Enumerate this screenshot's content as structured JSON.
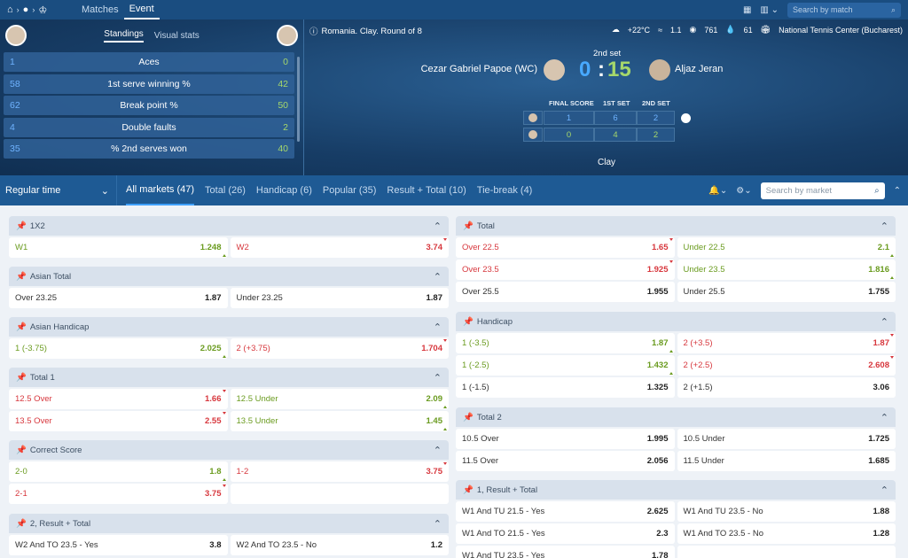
{
  "top": {
    "tabs": [
      "Matches",
      "Event"
    ],
    "active_tab": "Event",
    "search_placeholder": "Search by match"
  },
  "stats": {
    "tabs": [
      "Standings",
      "Visual stats"
    ],
    "rows": [
      {
        "left": "1",
        "name": "Aces",
        "right": "0"
      },
      {
        "left": "58",
        "name": "1st serve winning %",
        "right": "42"
      },
      {
        "left": "62",
        "name": "Break point %",
        "right": "50"
      },
      {
        "left": "4",
        "name": "Double faults",
        "right": "2"
      },
      {
        "left": "35",
        "name": "% 2nd serves won",
        "right": "40"
      }
    ]
  },
  "event": {
    "info": "Romania. Clay. Round of 8",
    "weather": {
      "temp": "+22°C",
      "wind": "1.1",
      "pressure": "761",
      "humidity": "61",
      "venue": "National Tennis Center (Bucharest)"
    },
    "set_label": "2nd set",
    "player1": "Cezar Gabriel Papoe (WC)",
    "player2": "Aljaz Jeran",
    "score1": "0",
    "colon": ":",
    "score2": "15",
    "scoreboard_heads": [
      "FINAL SCORE",
      "1ST SET",
      "2ND SET"
    ],
    "p1_scores": [
      "1",
      "6",
      "2"
    ],
    "p2_scores": [
      "0",
      "4",
      "2"
    ],
    "surface": "Clay"
  },
  "filters": {
    "period": "Regular time",
    "tabs": [
      {
        "label": "All markets (47)"
      },
      {
        "label": "Total (26)"
      },
      {
        "label": "Handicap (6)"
      },
      {
        "label": "Popular (35)"
      },
      {
        "label": "Result + Total (10)"
      },
      {
        "label": "Tie-break (4)"
      }
    ],
    "search_placeholder": "Search by market"
  },
  "markets_left": [
    {
      "title": "1X2",
      "rows": [
        [
          {
            "l": "W1",
            "v": "1.248",
            "t": "up"
          },
          {
            "l": "W2",
            "v": "3.74",
            "t": "down"
          }
        ]
      ]
    },
    {
      "title": "Asian Total",
      "rows": [
        [
          {
            "l": "Over 23.25",
            "v": "1.87",
            "t": ""
          },
          {
            "l": "Under 23.25",
            "v": "1.87",
            "t": ""
          }
        ]
      ]
    },
    {
      "title": "Asian Handicap",
      "rows": [
        [
          {
            "l": "1 (-3.75)",
            "v": "2.025",
            "t": "up"
          },
          {
            "l": "2 (+3.75)",
            "v": "1.704",
            "t": "down"
          }
        ]
      ]
    },
    {
      "title": "Total 1",
      "rows": [
        [
          {
            "l": "12.5 Over",
            "v": "1.66",
            "t": "down"
          },
          {
            "l": "12.5 Under",
            "v": "2.09",
            "t": "up"
          }
        ],
        [
          {
            "l": "13.5 Over",
            "v": "2.55",
            "t": "down"
          },
          {
            "l": "13.5 Under",
            "v": "1.45",
            "t": "up"
          }
        ]
      ]
    },
    {
      "title": "Correct Score",
      "rows": [
        [
          {
            "l": "2-0",
            "v": "1.8",
            "t": "up"
          },
          {
            "l": "1-2",
            "v": "3.75",
            "t": "down"
          }
        ],
        [
          {
            "l": "2-1",
            "v": "3.75",
            "t": "down"
          },
          {
            "l": "",
            "v": "",
            "t": "empty"
          }
        ]
      ]
    },
    {
      "title": "2, Result + Total",
      "rows": [
        [
          {
            "l": "W2 And TO 23.5 - Yes",
            "v": "3.8",
            "t": ""
          },
          {
            "l": "W2 And TO 23.5 - No",
            "v": "1.2",
            "t": ""
          }
        ]
      ]
    }
  ],
  "markets_right": [
    {
      "title": "Total",
      "rows": [
        [
          {
            "l": "Over 22.5",
            "v": "1.65",
            "t": "down"
          },
          {
            "l": "Under 22.5",
            "v": "2.1",
            "t": "up"
          }
        ],
        [
          {
            "l": "Over 23.5",
            "v": "1.925",
            "t": "down"
          },
          {
            "l": "Under 23.5",
            "v": "1.816",
            "t": "up"
          }
        ],
        [
          {
            "l": "Over 25.5",
            "v": "1.955",
            "t": ""
          },
          {
            "l": "Under 25.5",
            "v": "1.755",
            "t": ""
          }
        ]
      ]
    },
    {
      "title": "Handicap",
      "rows": [
        [
          {
            "l": "1 (-3.5)",
            "v": "1.87",
            "t": "up"
          },
          {
            "l": "2 (+3.5)",
            "v": "1.87",
            "t": "down"
          }
        ],
        [
          {
            "l": "1 (-2.5)",
            "v": "1.432",
            "t": "up"
          },
          {
            "l": "2 (+2.5)",
            "v": "2.608",
            "t": "down"
          }
        ],
        [
          {
            "l": "1 (-1.5)",
            "v": "1.325",
            "t": ""
          },
          {
            "l": "2 (+1.5)",
            "v": "3.06",
            "t": ""
          }
        ]
      ]
    },
    {
      "title": "Total 2",
      "rows": [
        [
          {
            "l": "10.5 Over",
            "v": "1.995",
            "t": ""
          },
          {
            "l": "10.5 Under",
            "v": "1.725",
            "t": ""
          }
        ],
        [
          {
            "l": "11.5 Over",
            "v": "2.056",
            "t": ""
          },
          {
            "l": "11.5 Under",
            "v": "1.685",
            "t": ""
          }
        ]
      ]
    },
    {
      "title": "1, Result + Total",
      "rows": [
        [
          {
            "l": "W1 And TU 21.5 - Yes",
            "v": "2.625",
            "t": ""
          },
          {
            "l": "W1 And TU 23.5 - No",
            "v": "1.88",
            "t": ""
          }
        ],
        [
          {
            "l": "W1 And TO 21.5 - Yes",
            "v": "2.3",
            "t": ""
          },
          {
            "l": "W1 And TO 23.5 - No",
            "v": "1.28",
            "t": ""
          }
        ],
        [
          {
            "l": "W1 And TU 23.5 - Yes",
            "v": "1.78",
            "t": ""
          },
          {
            "l": "",
            "v": "",
            "t": "empty"
          }
        ]
      ]
    }
  ]
}
